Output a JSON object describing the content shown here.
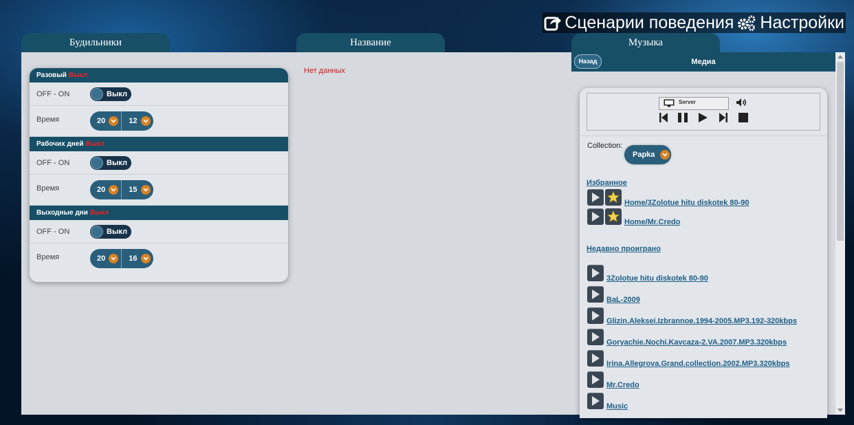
{
  "nav": {
    "scenarios": "Сценарии поведения",
    "settings": "Настройки"
  },
  "tabs": [
    "Будильники",
    "Название",
    "Музыка"
  ],
  "alarms": [
    {
      "title": "Разовый",
      "state": "Выкл",
      "toggle_label": "OFF - ON",
      "toggle_value": "Выкл",
      "time_label": "Время",
      "hour": "20",
      "minute": "12"
    },
    {
      "title": "Рабочих дней",
      "state": "Выкл",
      "toggle_label": "OFF - ON",
      "toggle_value": "Выкл",
      "time_label": "Время",
      "hour": "20",
      "minute": "15"
    },
    {
      "title": "Выходные дни",
      "state": "Выкл",
      "toggle_label": "OFF - ON",
      "toggle_value": "Выкл",
      "time_label": "Время",
      "hour": "20",
      "minute": "16"
    }
  ],
  "name_panel": {
    "empty": "Нет данных"
  },
  "media": {
    "back": "Назад",
    "title": "Медиа",
    "device": "Server",
    "collection_label": "Collection:",
    "collection_value": "Papka",
    "favorites_title": "Избранное",
    "favorites": [
      "Home/3Zolotue hitu diskotek 80-90",
      "Home/Mr.Credo"
    ],
    "recent_title": "Недавно проиграно",
    "recent": [
      "3Zolotue hitu diskotek 80-90",
      "BaL-2009",
      "Glizin.Aleksei.Izbrannoe.1994-2005.MP3.192-320kbps",
      "Goryachie.Nochi.Kavcaza-2.VA.2007.MP3.320kbps",
      "Irina.Allegrova.Grand.collection.2002.MP3.320kbps",
      "Mr.Credo",
      "Music"
    ]
  },
  "colors": {
    "header": "#174f67",
    "accent_orange": "#d88224",
    "link": "#1f5f86",
    "off_red": "#e22222"
  }
}
